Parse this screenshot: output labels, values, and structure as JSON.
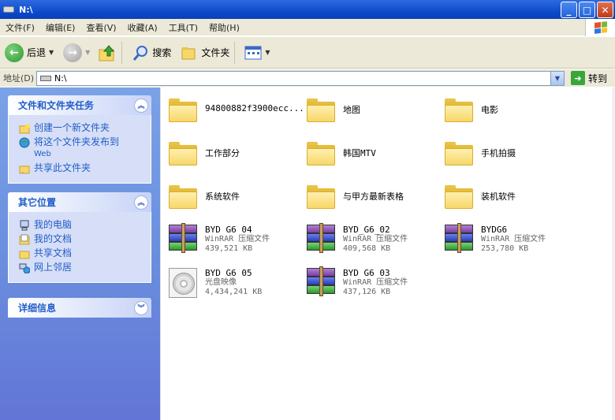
{
  "window": {
    "title": "N:\\"
  },
  "menu": [
    "文件(F)",
    "编辑(E)",
    "查看(V)",
    "收藏(A)",
    "工具(T)",
    "帮助(H)"
  ],
  "toolbar": {
    "back": "后退",
    "search": "搜索",
    "folders": "文件夹"
  },
  "address": {
    "label": "地址(D)",
    "value": "N:\\",
    "go": "转到"
  },
  "panels": {
    "tasks": {
      "title": "文件和文件夹任务",
      "items": [
        {
          "label": "创建一个新文件夹",
          "icon": "new-folder-icon"
        },
        {
          "label": "将这个文件夹发布到",
          "sub": "Web",
          "icon": "publish-web-icon"
        },
        {
          "label": "共享此文件夹",
          "icon": "share-folder-icon"
        }
      ]
    },
    "places": {
      "title": "其它位置",
      "items": [
        {
          "label": "我的电脑",
          "icon": "my-computer-icon"
        },
        {
          "label": "我的文档",
          "icon": "my-documents-icon"
        },
        {
          "label": "共享文档",
          "icon": "shared-documents-icon"
        },
        {
          "label": "网上邻居",
          "icon": "network-icon"
        }
      ]
    },
    "details": {
      "title": "详细信息"
    }
  },
  "files": [
    {
      "name": "94800882f3900ecc...",
      "type": "folder"
    },
    {
      "name": "地图",
      "type": "folder"
    },
    {
      "name": "电影",
      "type": "folder"
    },
    {
      "name": "工作部分",
      "type": "folder"
    },
    {
      "name": "韩国MTV",
      "type": "folder"
    },
    {
      "name": "手机拍摄",
      "type": "folder"
    },
    {
      "name": "系统软件",
      "type": "folder"
    },
    {
      "name": "与甲方最新表格",
      "type": "folder"
    },
    {
      "name": "装机软件",
      "type": "folder"
    },
    {
      "name": "BYD G6 04",
      "type": "rar",
      "kind": "WinRAR 压缩文件",
      "size": "439,521 KB"
    },
    {
      "name": "BYD_G6_02",
      "type": "rar",
      "kind": "WinRAR 压缩文件",
      "size": "409,568 KB"
    },
    {
      "name": "BYDG6",
      "type": "rar",
      "kind": "WinRAR 压缩文件",
      "size": "253,780 KB"
    },
    {
      "name": "BYD G6 05",
      "type": "iso",
      "kind": "光盘映像",
      "size": "4,434,241 KB"
    },
    {
      "name": "BYD G6 03",
      "type": "rar",
      "kind": "WinRAR 压缩文件",
      "size": "437,126 KB"
    }
  ]
}
